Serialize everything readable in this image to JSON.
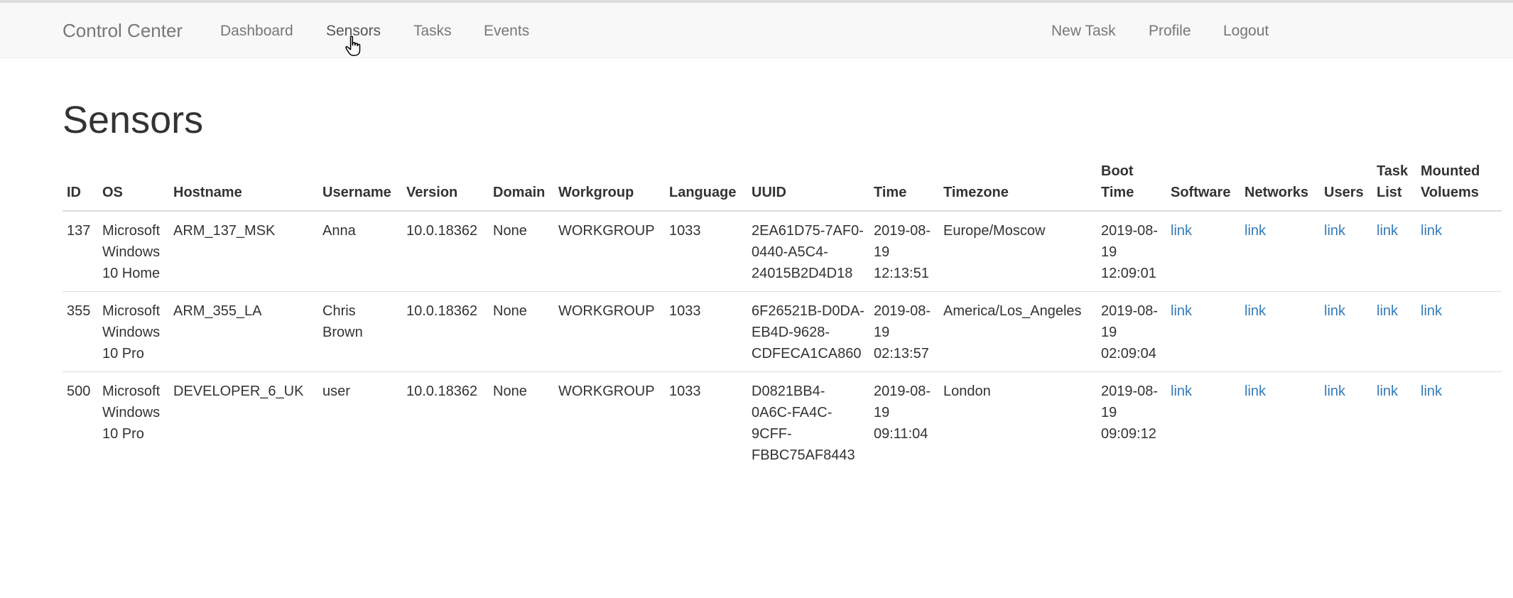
{
  "nav": {
    "brand": "Control Center",
    "links": [
      "Dashboard",
      "Sensors",
      "Tasks",
      "Events"
    ],
    "right_links": [
      "New Task",
      "Profile",
      "Logout"
    ],
    "active": "Sensors"
  },
  "page": {
    "title": "Sensors"
  },
  "table": {
    "headers": [
      "ID",
      "OS",
      "Hostname",
      "Username",
      "Version",
      "Domain",
      "Workgroup",
      "Language",
      "UUID",
      "Time",
      "Timezone",
      "Boot Time",
      "Software",
      "Networks",
      "Users",
      "Task List",
      "Mounted Voluems"
    ],
    "link_label": "link",
    "rows": [
      {
        "id": "137",
        "os": "Microsoft Windows 10 Home",
        "hostname": "ARM_137_MSK",
        "username": "Anna",
        "version": "10.0.18362",
        "domain": "None",
        "workgroup": "WORKGROUP",
        "language": "1033",
        "uuid": "2EA61D75-7AF0-0440-A5C4-24015B2D4D18",
        "time": "2019-08-19 12:13:51",
        "timezone": "Europe/Moscow",
        "boot_time": "2019-08-19 12:09:01"
      },
      {
        "id": "355",
        "os": "Microsoft Windows 10 Pro",
        "hostname": "ARM_355_LA",
        "username": "Chris Brown",
        "version": "10.0.18362",
        "domain": "None",
        "workgroup": "WORKGROUP",
        "language": "1033",
        "uuid": "6F26521B-D0DA-EB4D-9628-CDFECA1CA860",
        "time": "2019-08-19 02:13:57",
        "timezone": "America/Los_Angeles",
        "boot_time": "2019-08-19 02:09:04"
      },
      {
        "id": "500",
        "os": "Microsoft Windows 10 Pro",
        "hostname": "DEVELOPER_6_UK",
        "username": "user",
        "version": "10.0.18362",
        "domain": "None",
        "workgroup": "WORKGROUP",
        "language": "1033",
        "uuid": "D0821BB4-0A6C-FA4C-9CFF-FBBC75AF8443",
        "time": "2019-08-19 09:11:04",
        "timezone": "London",
        "boot_time": "2019-08-19 09:09:12"
      }
    ]
  },
  "icons": {
    "cursor": "hand-pointer-icon"
  }
}
